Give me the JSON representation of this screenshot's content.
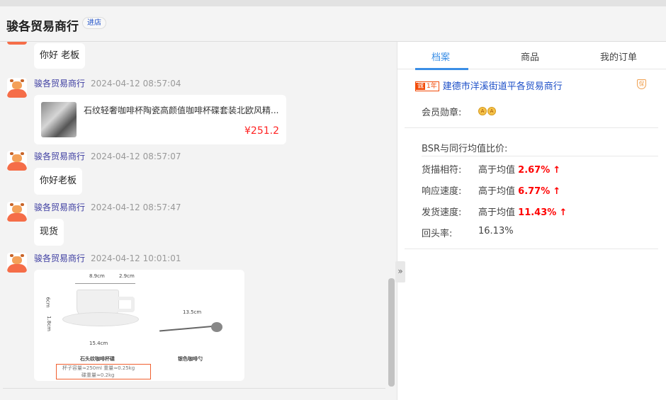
{
  "header": {
    "shop_name": "骏各贸易商行",
    "enter_store": "进店"
  },
  "messages": [
    {
      "text": "你好 老板"
    },
    {
      "sender": "骏各贸易商行",
      "time": "2024-04-12 08:57:04",
      "product": {
        "title": "石纹轻奢咖啡杯陶瓷高颜值咖啡杯碟套装北欧风精...",
        "price": "¥251.2"
      }
    },
    {
      "sender": "骏各贸易商行",
      "time": "2024-04-12 08:57:07",
      "text": "你好老板"
    },
    {
      "sender": "骏各贸易商行",
      "time": "2024-04-12 08:57:47",
      "text": "现货"
    },
    {
      "sender": "骏各贸易商行",
      "time": "2024-04-12 10:01:01",
      "image": {
        "dim1": "8.9cm",
        "dim2": "2.9cm",
        "dim3": "6cm",
        "dim4": "1.8cm",
        "dim5": "15.4cm",
        "dim6": "13.5cm",
        "label1": "石头纹咖啡杯碟",
        "label2": "银色咖啡勺",
        "spec1": "杯子容量≈250ml 重量≈0.25kg",
        "spec2": "碟重量≈0.2kg"
      }
    }
  ],
  "panel": {
    "tabs": [
      "档案",
      "商品",
      "我的订单"
    ],
    "badge_icon": "诚",
    "badge_years": "1年",
    "company": "建德市洋溪街道平各贸易商行",
    "shield": "保",
    "medal_label": "会员勋章:",
    "medal": "A",
    "bsr_title": "BSR与同行均值比价:",
    "stats": [
      {
        "label": "货描相符:",
        "prefix": "高于均值",
        "value": "2.67%",
        "arrow": "↑"
      },
      {
        "label": "响应速度:",
        "prefix": "高于均值",
        "value": "6.77%",
        "arrow": "↑"
      },
      {
        "label": "发货速度:",
        "prefix": "高于均值",
        "value": "11.43%",
        "arrow": "↑"
      }
    ],
    "repeat_label": "回头率:",
    "repeat_value": "16.13%"
  },
  "collapse_icon": "»"
}
